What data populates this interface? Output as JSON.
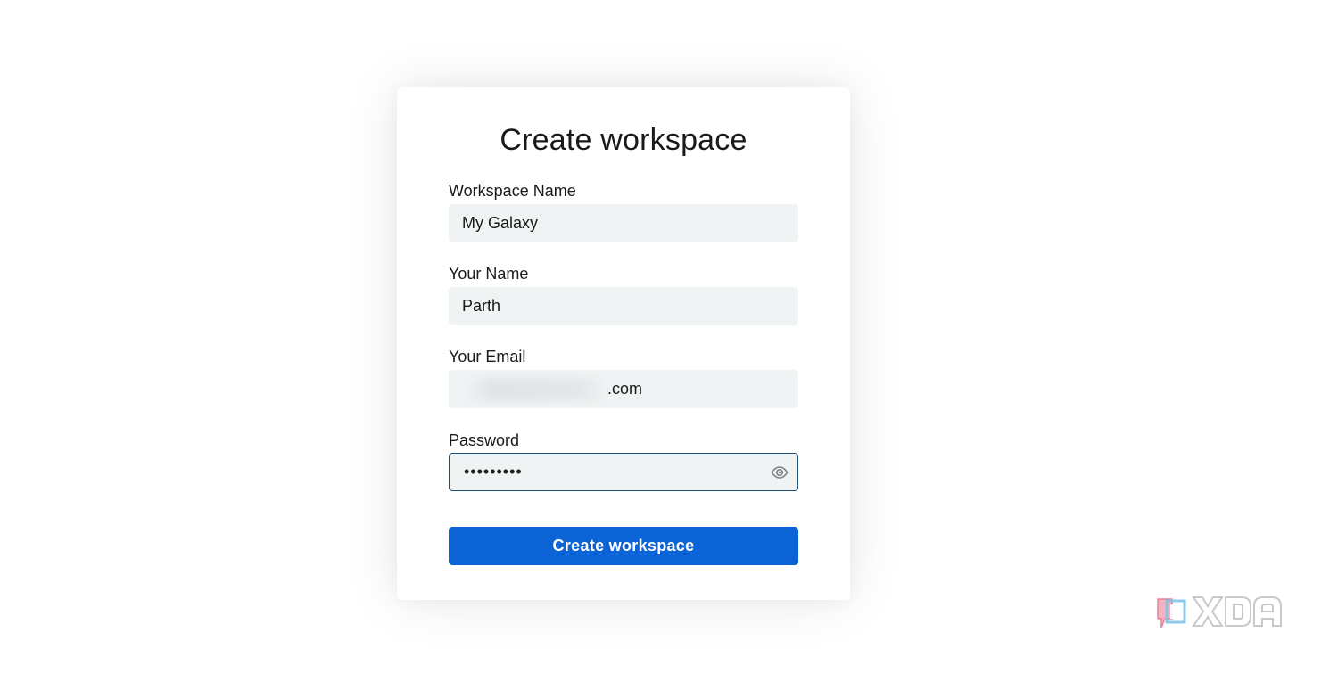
{
  "form": {
    "title": "Create workspace",
    "workspace_name": {
      "label": "Workspace Name",
      "value": "My Galaxy"
    },
    "your_name": {
      "label": "Your Name",
      "value": "Parth"
    },
    "your_email": {
      "label": "Your Email",
      "value_visible_suffix": ".com"
    },
    "password": {
      "label": "Password",
      "masked_value": "•••••••••"
    },
    "submit_label": "Create workspace"
  },
  "icons": {
    "password_toggle": "eye-icon",
    "watermark": "xda-logo"
  },
  "colors": {
    "accent": "#0b63d6",
    "field_bg": "#eff3f3",
    "focus_border": "#1e4f7a"
  },
  "watermark": {
    "text": "XDA"
  }
}
